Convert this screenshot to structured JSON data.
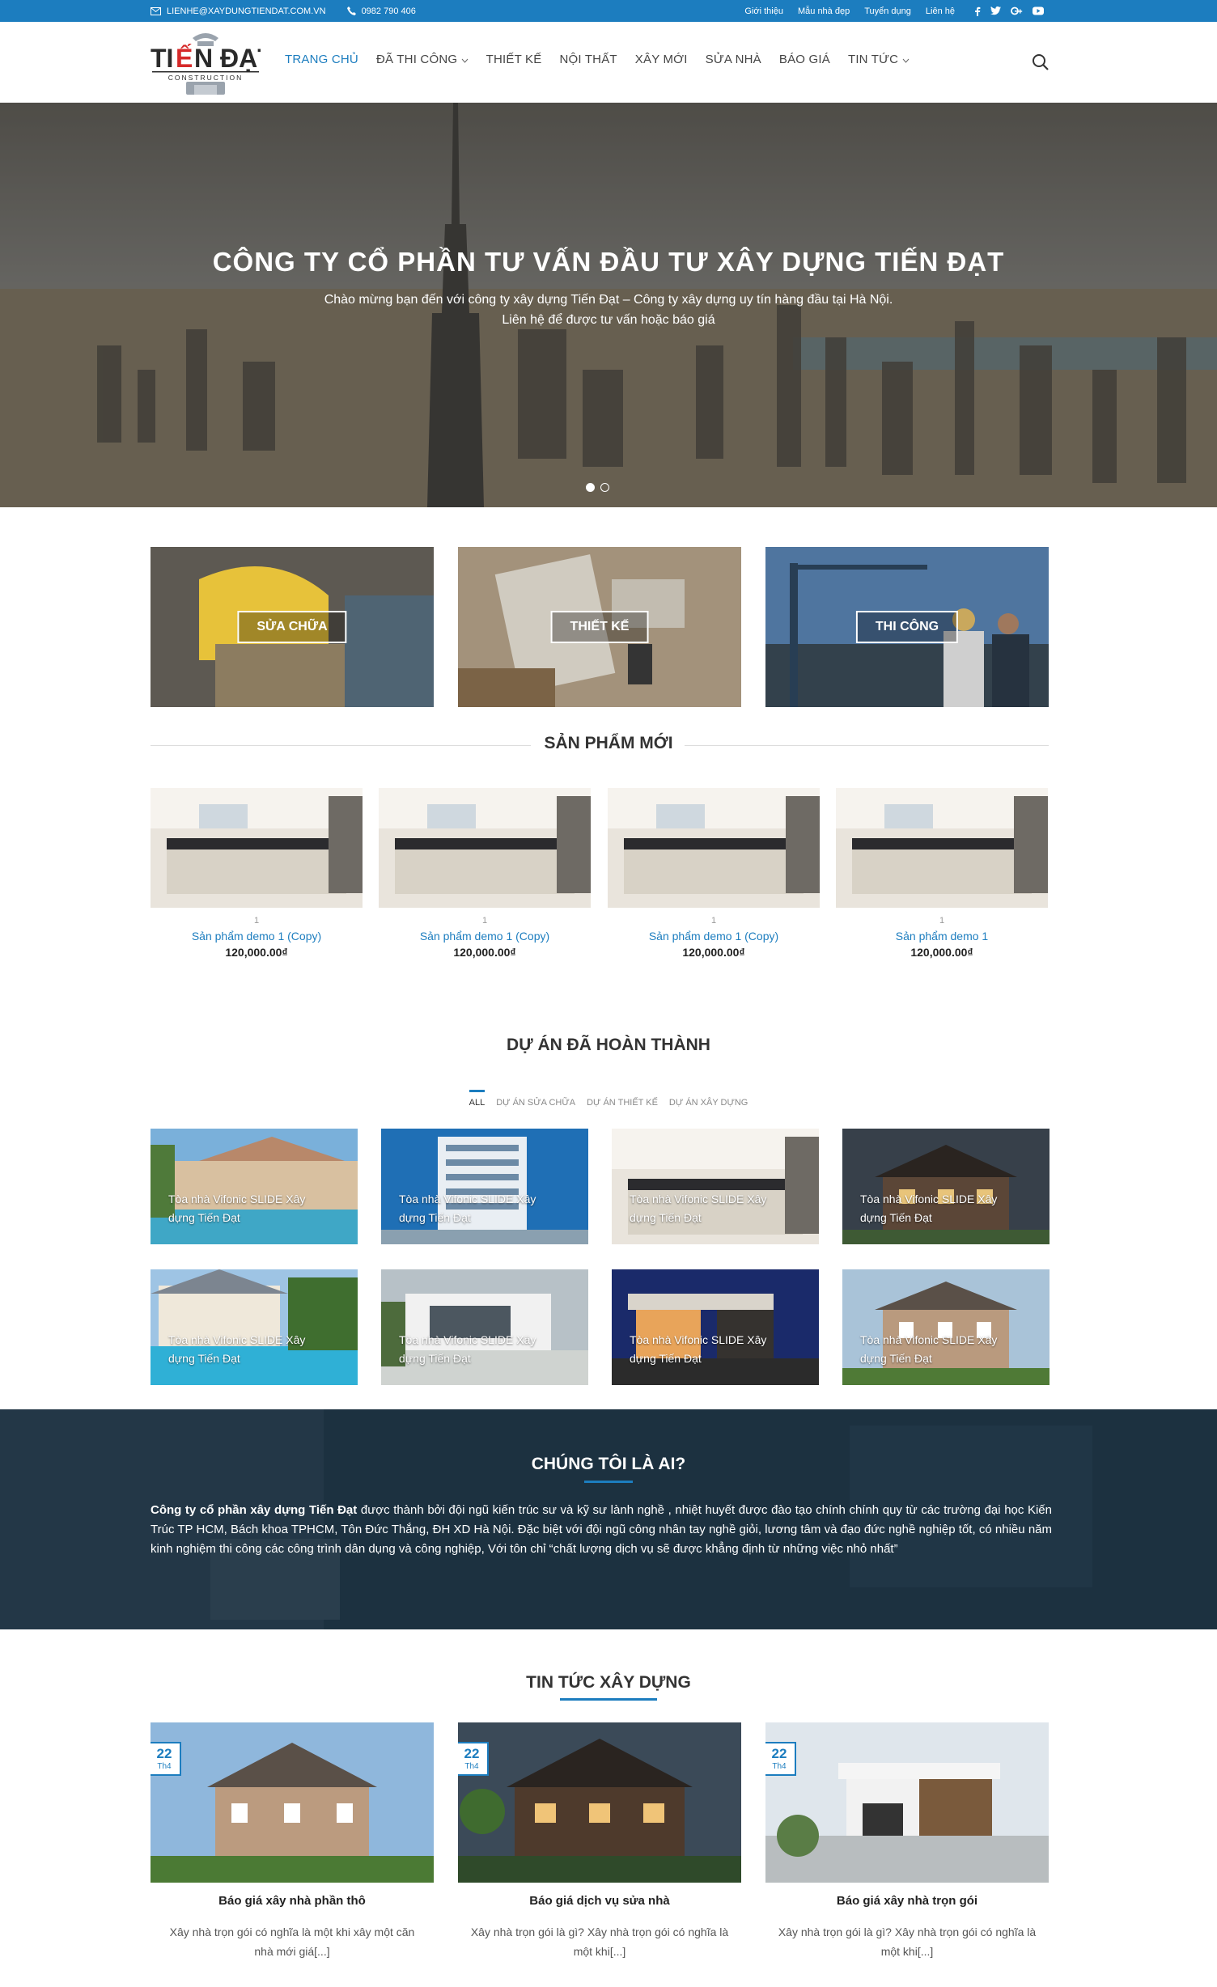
{
  "topbar": {
    "email": "LIENHE@XAYDUNGTIENDAT.COM.VN",
    "phone": "0982 790 406",
    "links": [
      "Giới thiệu",
      "Mẫu nhà đẹp",
      "Tuyển dụng",
      "Liên hệ"
    ],
    "social": [
      "facebook-icon",
      "twitter-icon",
      "google-plus-icon",
      "youtube-icon"
    ]
  },
  "logo": {
    "main": "TIẾN ĐẠT",
    "sub": "CONSTRUCTION"
  },
  "nav": {
    "items": [
      {
        "label": "TRANG CHỦ",
        "active": true
      },
      {
        "label": "ĐÃ THI CÔNG",
        "dropdown": true
      },
      {
        "label": "THIẾT KẾ"
      },
      {
        "label": "NỘI THẤT"
      },
      {
        "label": "XÂY MỚI"
      },
      {
        "label": "SỬA NHÀ"
      },
      {
        "label": "BÁO GIÁ"
      },
      {
        "label": "TIN TỨC",
        "dropdown": true
      }
    ]
  },
  "hero": {
    "title": "CÔNG TY CỔ PHẦN TƯ VẤN ĐẦU TƯ XÂY DỰNG TIẾN ĐẠT",
    "line1": "Chào mừng bạn đến với công ty xây dựng Tiến Đạt – Công ty xây dựng uy tín hàng đầu tại Hà Nội.",
    "line2": "Liên hệ để được tư vấn hoặc báo giá"
  },
  "services": [
    "SỬA CHỮA",
    "THIẾT KẾ",
    "THI CÔNG"
  ],
  "products": {
    "title": "SẢN PHẨM MỚI",
    "items": [
      {
        "cat": "1",
        "name": "Sản phẩm demo 1 (Copy)",
        "price": "120,000.00₫"
      },
      {
        "cat": "1",
        "name": "Sản phẩm demo 1 (Copy)",
        "price": "120,000.00₫"
      },
      {
        "cat": "1",
        "name": "Sản phẩm demo 1 (Copy)",
        "price": "120,000.00₫"
      },
      {
        "cat": "1",
        "name": "Sản phẩm demo 1",
        "price": "120,000.00₫"
      }
    ]
  },
  "projects": {
    "title": "DỰ ÁN ĐÃ HOÀN THÀNH",
    "filters": [
      "ALL",
      "DỰ ÁN SỬA CHỮA",
      "DỰ ÁN THIẾT KẾ",
      "DỰ ÁN XÂY DỰNG"
    ],
    "caption": "Tòa nhà Vifonic SLIDE Xây dựng Tiến Đạt"
  },
  "about": {
    "title": "CHÚNG TÔI LÀ AI?",
    "bold": "Công ty cổ phần xây dựng Tiến Đạt",
    "text": " được thành bởi đội ngũ kiến trúc sư và kỹ sư lành nghề , nhiệt huyết được đào tạo chính chính quy từ các trường đại học Kiến Trúc TP HCM, Bách khoa TPHCM, Tôn Đức Thắng, ĐH XD Hà Nội. Đặc biệt với đội ngũ công nhân tay nghề giỏi, lương tâm và đạo đức nghề nghiệp tốt, có nhiều năm kinh nghiệm thi công các công trình dân dụng và công nghiệp, Với tôn chỉ “chất lượng dịch vụ sẽ được khẳng định từ những việc nhỏ nhất”"
  },
  "news": {
    "title": "TIN TỨC XÂY DỰNG",
    "items": [
      {
        "day": "22",
        "month": "Th4",
        "title": "Báo giá xây nhà phần thô",
        "excerpt": "Xây nhà trọn gói có nghĩa là một khi xây một căn nhà mới giá[...]"
      },
      {
        "day": "22",
        "month": "Th4",
        "title": "Báo giá dịch vụ sửa nhà",
        "excerpt": "Xây nhà trọn gói là gì? Xây nhà trọn gói có nghĩa là một khi[...]"
      },
      {
        "day": "22",
        "month": "Th4",
        "title": "Báo giá xây nhà trọn gói",
        "excerpt": "Xây nhà trọn gói là gì? Xây nhà trọn gói có nghĩa là một khi[...]"
      }
    ]
  },
  "colors": {
    "accent": "#1c7dbf",
    "text": "#333333"
  }
}
